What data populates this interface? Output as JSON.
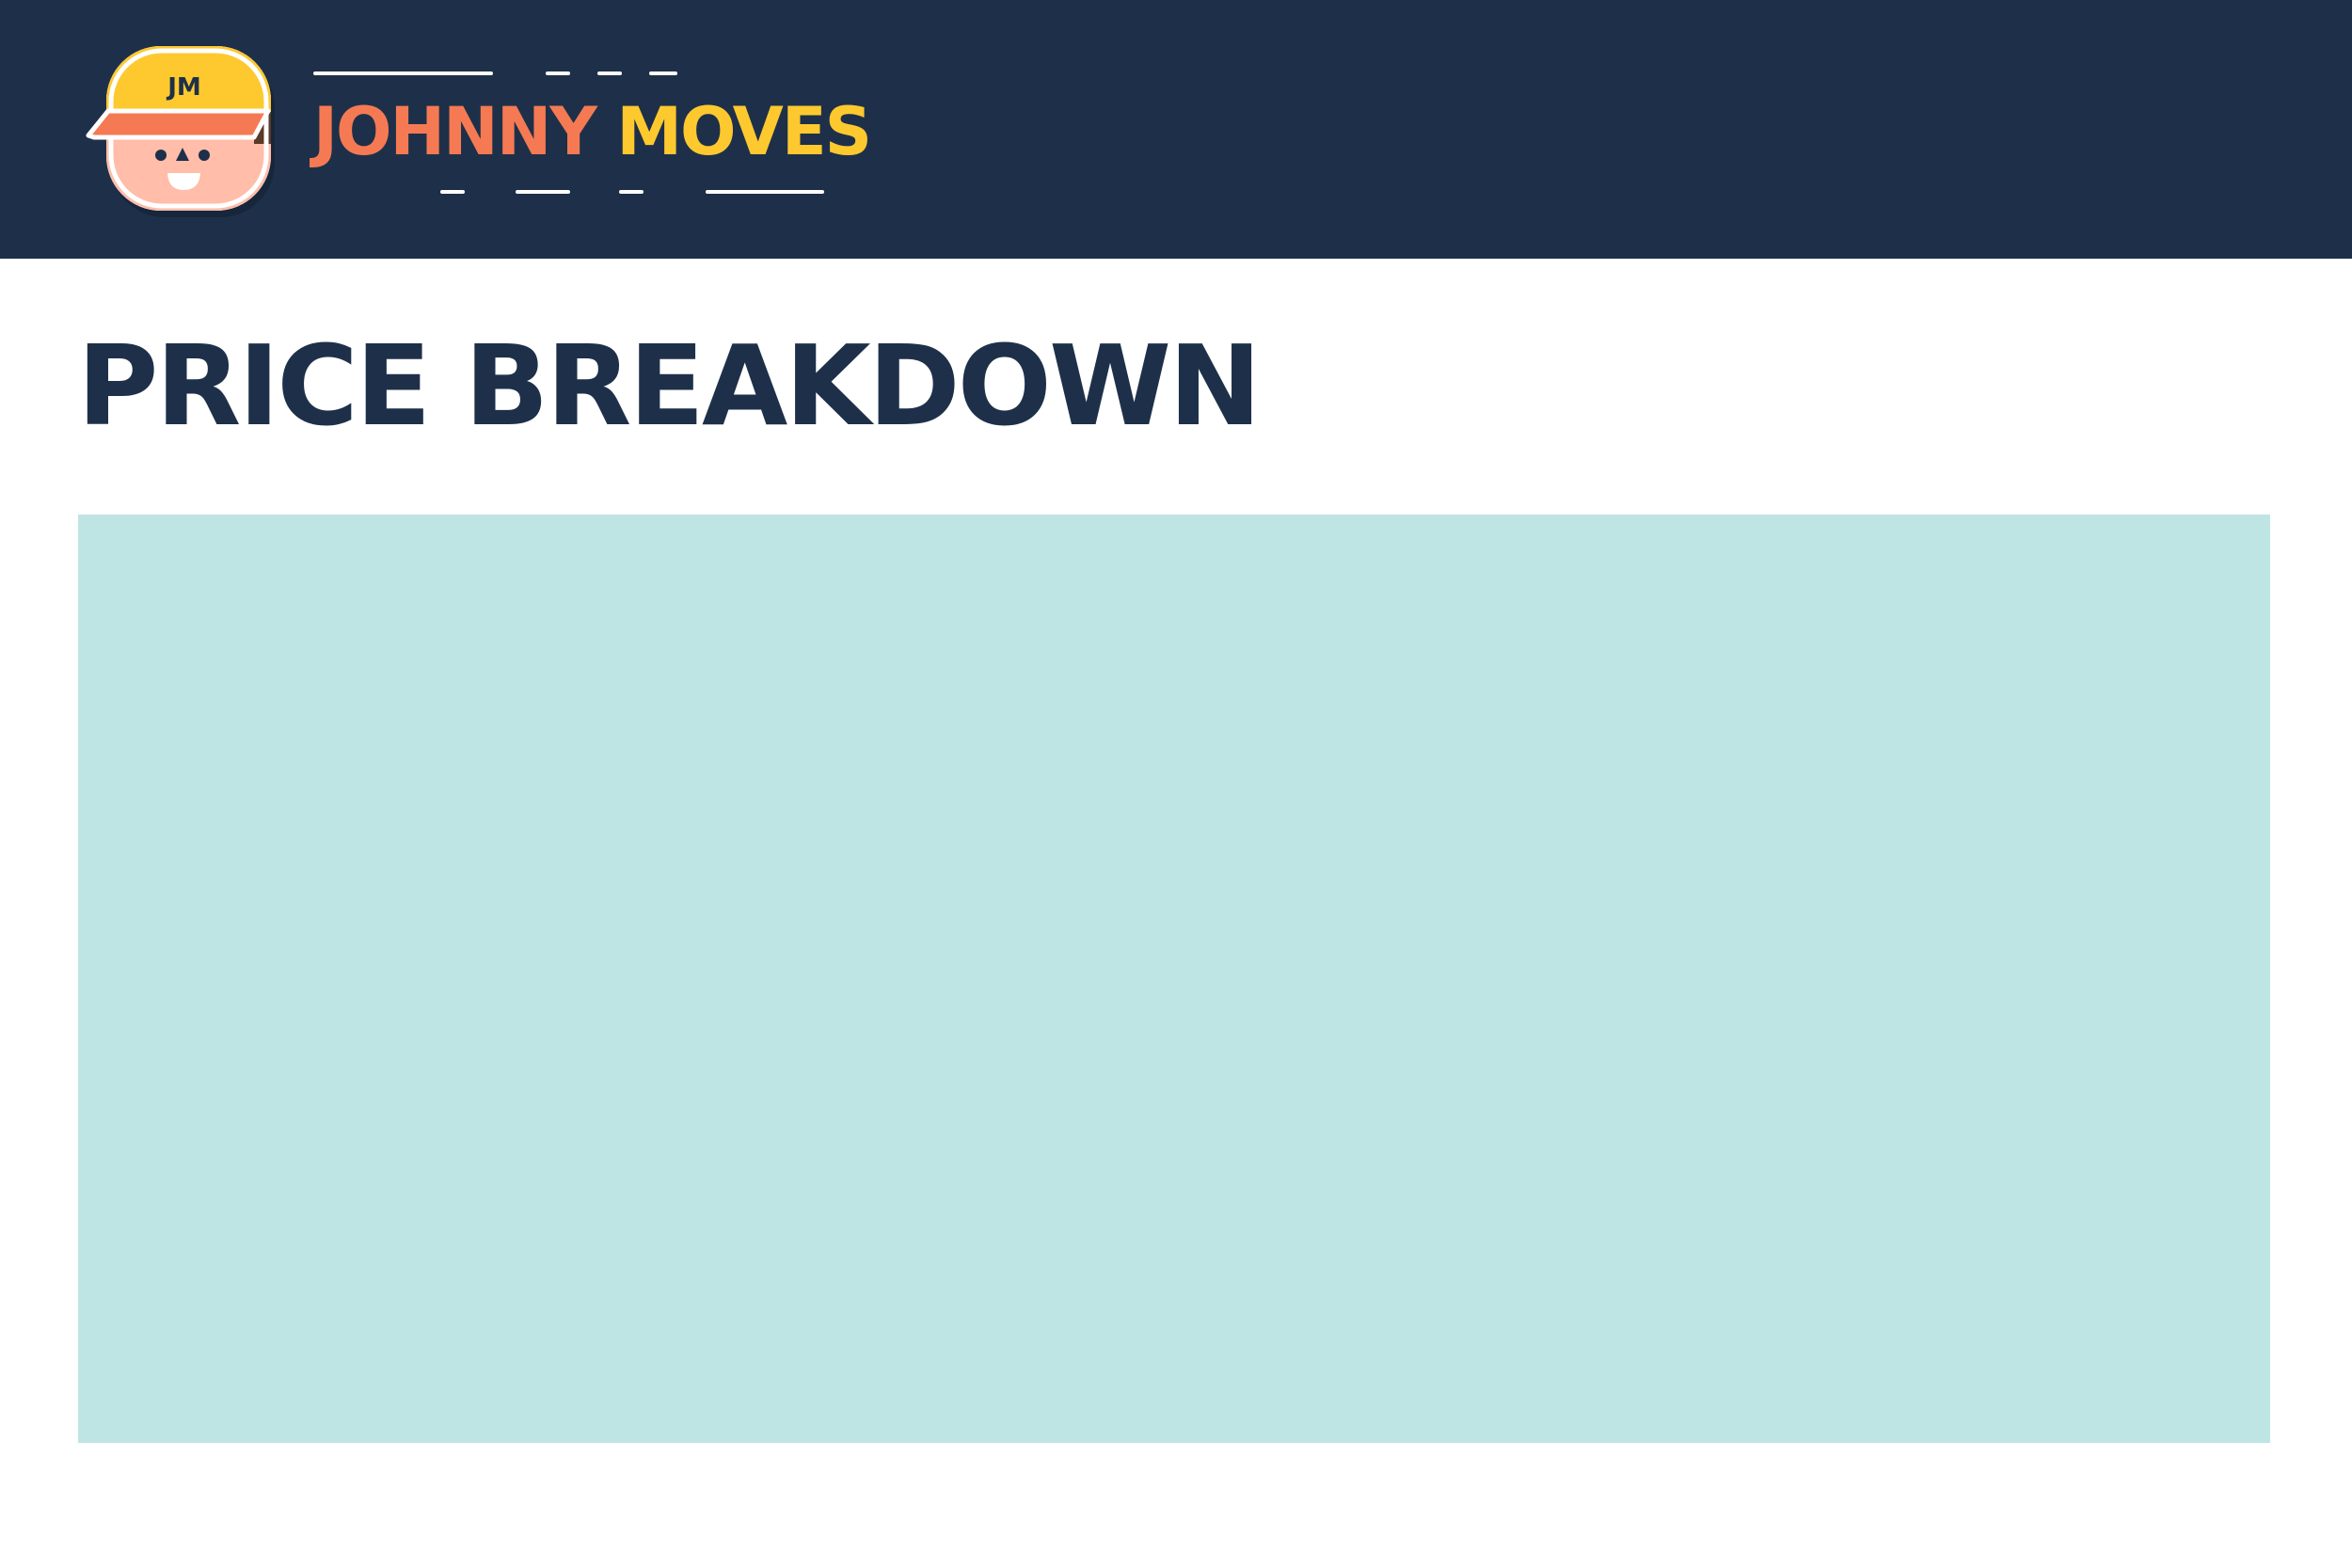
{
  "header": {
    "background_color": "#1e3049",
    "logo": {
      "icon": "mover-mascot-icon",
      "cap_initials": "JM",
      "cap_color": "#fdc92f",
      "visor_color": "#f57a53",
      "face_color": "#ffbdaa"
    },
    "brand": {
      "first_word": "JOHNNY",
      "second_word": "MOVES",
      "first_word_color": "#f57a53",
      "second_word_color": "#fdc92f"
    }
  },
  "main": {
    "title": "PRICE BREAKDOWN",
    "title_color": "#1e3049",
    "panel_color": "#bee5e4"
  }
}
